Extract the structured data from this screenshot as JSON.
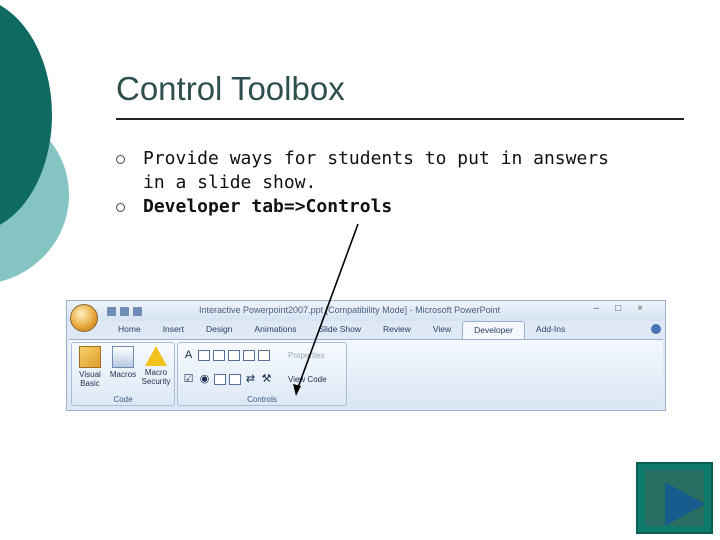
{
  "slide": {
    "title": "Control Toolbox",
    "bullets": [
      "Provide ways for students to put in answers in a slide show.",
      "Developer tab=>Controls"
    ]
  },
  "ribbon": {
    "window_title": "Interactive Powerpoint2007.ppt [Compatibility Mode] - Microsoft PowerPoint",
    "tabs": [
      "Home",
      "Insert",
      "Design",
      "Animations",
      "Slide Show",
      "Review",
      "View",
      "Developer",
      "Add-Ins"
    ],
    "active_tab": "Developer",
    "groups": {
      "code": {
        "label": "Code",
        "buttons": [
          "Visual Basic",
          "Macros",
          "Macro Security"
        ]
      },
      "controls": {
        "label": "Controls",
        "properties_label": "Properties",
        "view_code_label": "View Code"
      }
    }
  },
  "colors": {
    "teal_dark": "#0f6b62",
    "teal_light": "#84c4c2",
    "nav_button": "#0d7a6c",
    "nav_arrow": "#155b8c"
  },
  "icons": {
    "next": "next-slide-arrow-icon"
  }
}
